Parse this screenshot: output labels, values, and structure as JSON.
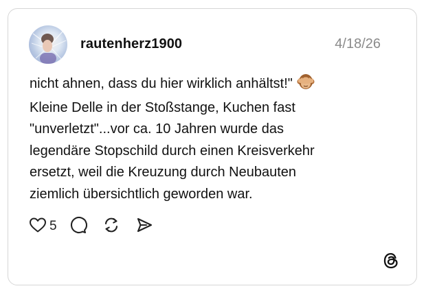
{
  "post": {
    "username": "rautenherz1900",
    "date": "4/18/26",
    "text_lines": [
      "nicht ahnen, dass du hier wirklich anhältst!\"",
      "Kleine Delle in der Stoßstange, Kuchen fast",
      "\"unverletzt\"...vor ca. 10 Jahren wurde das",
      "legendäre Stopschild durch einen Kreisverkehr",
      "ersetzt, weil die Kreuzung durch Neubauten",
      "ziemlich übersichtlich geworden war."
    ],
    "emoji": "see-no-evil-monkey",
    "likes": "5"
  },
  "icons": {
    "like": "heart-icon",
    "comment": "comment-icon",
    "repost": "repost-icon",
    "share": "send-icon",
    "brand": "threads-logo-icon"
  },
  "colors": {
    "text": "#111111",
    "date": "#8a8a8a",
    "border": "#d6d6d6"
  }
}
